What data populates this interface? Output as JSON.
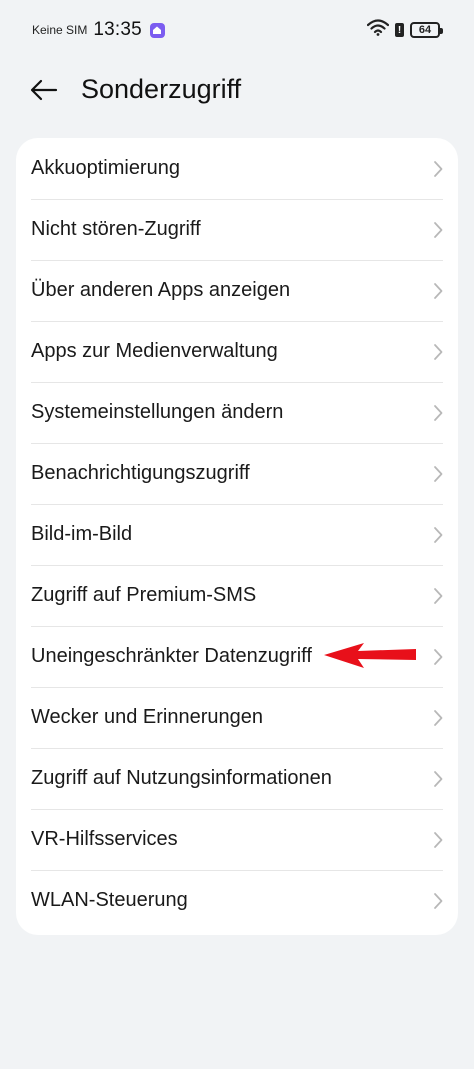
{
  "status_bar": {
    "carrier": "Keine SIM",
    "time": "13:35",
    "alert": "!",
    "battery": "64"
  },
  "header": {
    "title": "Sonderzugriff"
  },
  "menu": {
    "items": [
      {
        "label": "Akkuoptimierung"
      },
      {
        "label": "Nicht stören-Zugriff"
      },
      {
        "label": "Über anderen Apps anzeigen"
      },
      {
        "label": "Apps zur Medienverwaltung"
      },
      {
        "label": "Systemeinstellungen ändern"
      },
      {
        "label": "Benachrichtigungszugriff"
      },
      {
        "label": "Bild-im-Bild"
      },
      {
        "label": "Zugriff auf Premium-SMS"
      },
      {
        "label": "Uneingeschränkter Datenzugriff"
      },
      {
        "label": "Wecker und Erinnerungen"
      },
      {
        "label": "Zugriff auf Nutzungsinformationen"
      },
      {
        "label": "VR-Hilfsservices"
      },
      {
        "label": "WLAN-Steuerung"
      }
    ]
  },
  "icons": {
    "back": "arrow-left-icon",
    "chevron": "chevron-right-icon",
    "wifi": "wifi-icon",
    "battery": "battery-icon",
    "annotation": "red-arrow-icon"
  },
  "colors": {
    "background": "#f1f3f5",
    "card": "#ffffff",
    "chevron": "#b8b8b8",
    "annotation": "#e8101a",
    "app_badge": "#7b5cf0"
  }
}
